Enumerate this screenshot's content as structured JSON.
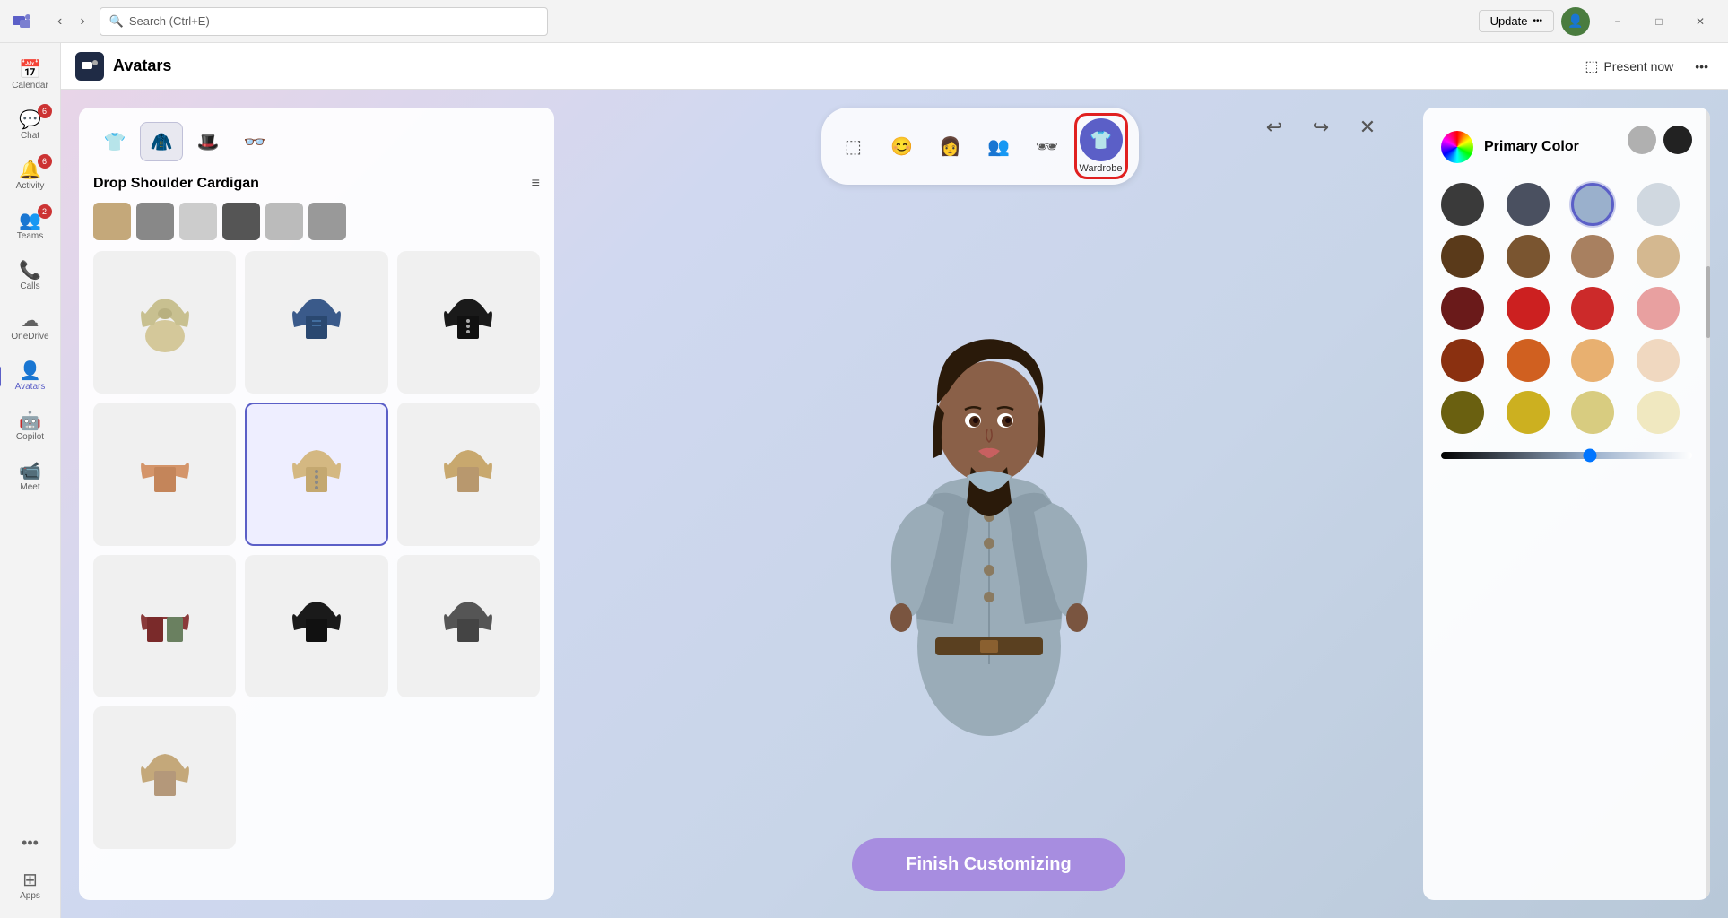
{
  "titlebar": {
    "search_placeholder": "Search (Ctrl+E)",
    "update_label": "Update",
    "update_dots": "•••",
    "minimize": "−",
    "maximize": "□",
    "close": "✕"
  },
  "sidebar": {
    "items": [
      {
        "id": "calendar",
        "label": "Calendar",
        "icon": "📅",
        "badge": null
      },
      {
        "id": "chat",
        "label": "Chat",
        "icon": "💬",
        "badge": "6"
      },
      {
        "id": "activity",
        "label": "Activity",
        "icon": "🔔",
        "badge": "6"
      },
      {
        "id": "teams",
        "label": "Teams",
        "icon": "👥",
        "badge": "2"
      },
      {
        "id": "calls",
        "label": "Calls",
        "icon": "📞",
        "badge": null
      },
      {
        "id": "onedrive",
        "label": "OneDrive",
        "icon": "☁",
        "badge": null
      },
      {
        "id": "avatars",
        "label": "Avatars",
        "icon": "👤",
        "badge": null,
        "active": true
      },
      {
        "id": "copilot",
        "label": "Copilot",
        "icon": "🤖",
        "badge": null
      },
      {
        "id": "meet",
        "label": "Meet",
        "icon": "📹",
        "badge": null
      },
      {
        "id": "apps",
        "label": "Apps",
        "icon": "⊞",
        "badge": null
      }
    ],
    "more_label": "•••"
  },
  "app_header": {
    "title": "Avatars",
    "present_label": "Present now",
    "present_more": "•••"
  },
  "toolbar": {
    "tabs": [
      {
        "id": "preset",
        "icon": "⬚",
        "label": ""
      },
      {
        "id": "face",
        "icon": "😊",
        "label": ""
      },
      {
        "id": "hairstyle",
        "icon": "👩",
        "label": ""
      },
      {
        "id": "body",
        "icon": "👥",
        "label": ""
      },
      {
        "id": "accessories",
        "icon": "🕶",
        "label": ""
      },
      {
        "id": "wardrobe",
        "icon": "👕",
        "label": "Wardrobe",
        "active": true
      }
    ],
    "undo": "↩",
    "redo": "↪",
    "close": "✕"
  },
  "wardrobe": {
    "tabs": [
      {
        "id": "top",
        "icon": "👕"
      },
      {
        "id": "pants",
        "icon": "👖",
        "active": true
      },
      {
        "id": "hat",
        "icon": "🎩"
      },
      {
        "id": "glasses",
        "icon": "👓"
      }
    ],
    "title": "Drop Shoulder Cardigan",
    "items": [
      {
        "id": 1,
        "color": "#d4c89a",
        "selected": false
      },
      {
        "id": 2,
        "color": "#3a5a8a",
        "selected": false
      },
      {
        "id": 3,
        "color": "#1a1a1a",
        "selected": false
      },
      {
        "id": 4,
        "color": "#d4956a",
        "selected": false
      },
      {
        "id": 5,
        "color": "#d4b882",
        "selected": true
      },
      {
        "id": 6,
        "color": "#c8a86e",
        "selected": false
      },
      {
        "id": 7,
        "color": "#8a3a3a",
        "selected": false
      },
      {
        "id": 8,
        "color": "#1a1a1a",
        "selected": false
      },
      {
        "id": 9,
        "color": "#555555",
        "selected": false
      },
      {
        "id": 10,
        "color": "#c4a87a",
        "selected": false
      }
    ]
  },
  "color_panel": {
    "title": "Primary Color",
    "presets": [
      {
        "color": "#b0b0b0"
      },
      {
        "color": "#222222"
      }
    ],
    "swatches": [
      {
        "color": "#3a3a3a",
        "selected": false
      },
      {
        "color": "#4a5060",
        "selected": false
      },
      {
        "color": "#9ab0cc",
        "selected": true
      },
      {
        "color": "#d0d8e0",
        "selected": false
      },
      {
        "color": "#5a3a1a",
        "selected": false
      },
      {
        "color": "#7a5530",
        "selected": false
      },
      {
        "color": "#a88060",
        "selected": false
      },
      {
        "color": "#d4b890",
        "selected": false
      },
      {
        "color": "#6a1a1a",
        "selected": false
      },
      {
        "color": "#cc2020",
        "selected": false
      },
      {
        "color": "#cc2a2a",
        "selected": false
      },
      {
        "color": "#e8a0a0",
        "selected": false
      },
      {
        "color": "#8a3010",
        "selected": false
      },
      {
        "color": "#d06020",
        "selected": false
      },
      {
        "color": "#e8b070",
        "selected": false
      },
      {
        "color": "#f0d8c0",
        "selected": false
      },
      {
        "color": "#6a6010",
        "selected": false
      },
      {
        "color": "#ccb020",
        "selected": false
      },
      {
        "color": "#d8cc80",
        "selected": false
      },
      {
        "color": "#f0e8c0",
        "selected": false
      }
    ],
    "slider_value": 60
  },
  "finish_btn_label": "Finish Customizing"
}
